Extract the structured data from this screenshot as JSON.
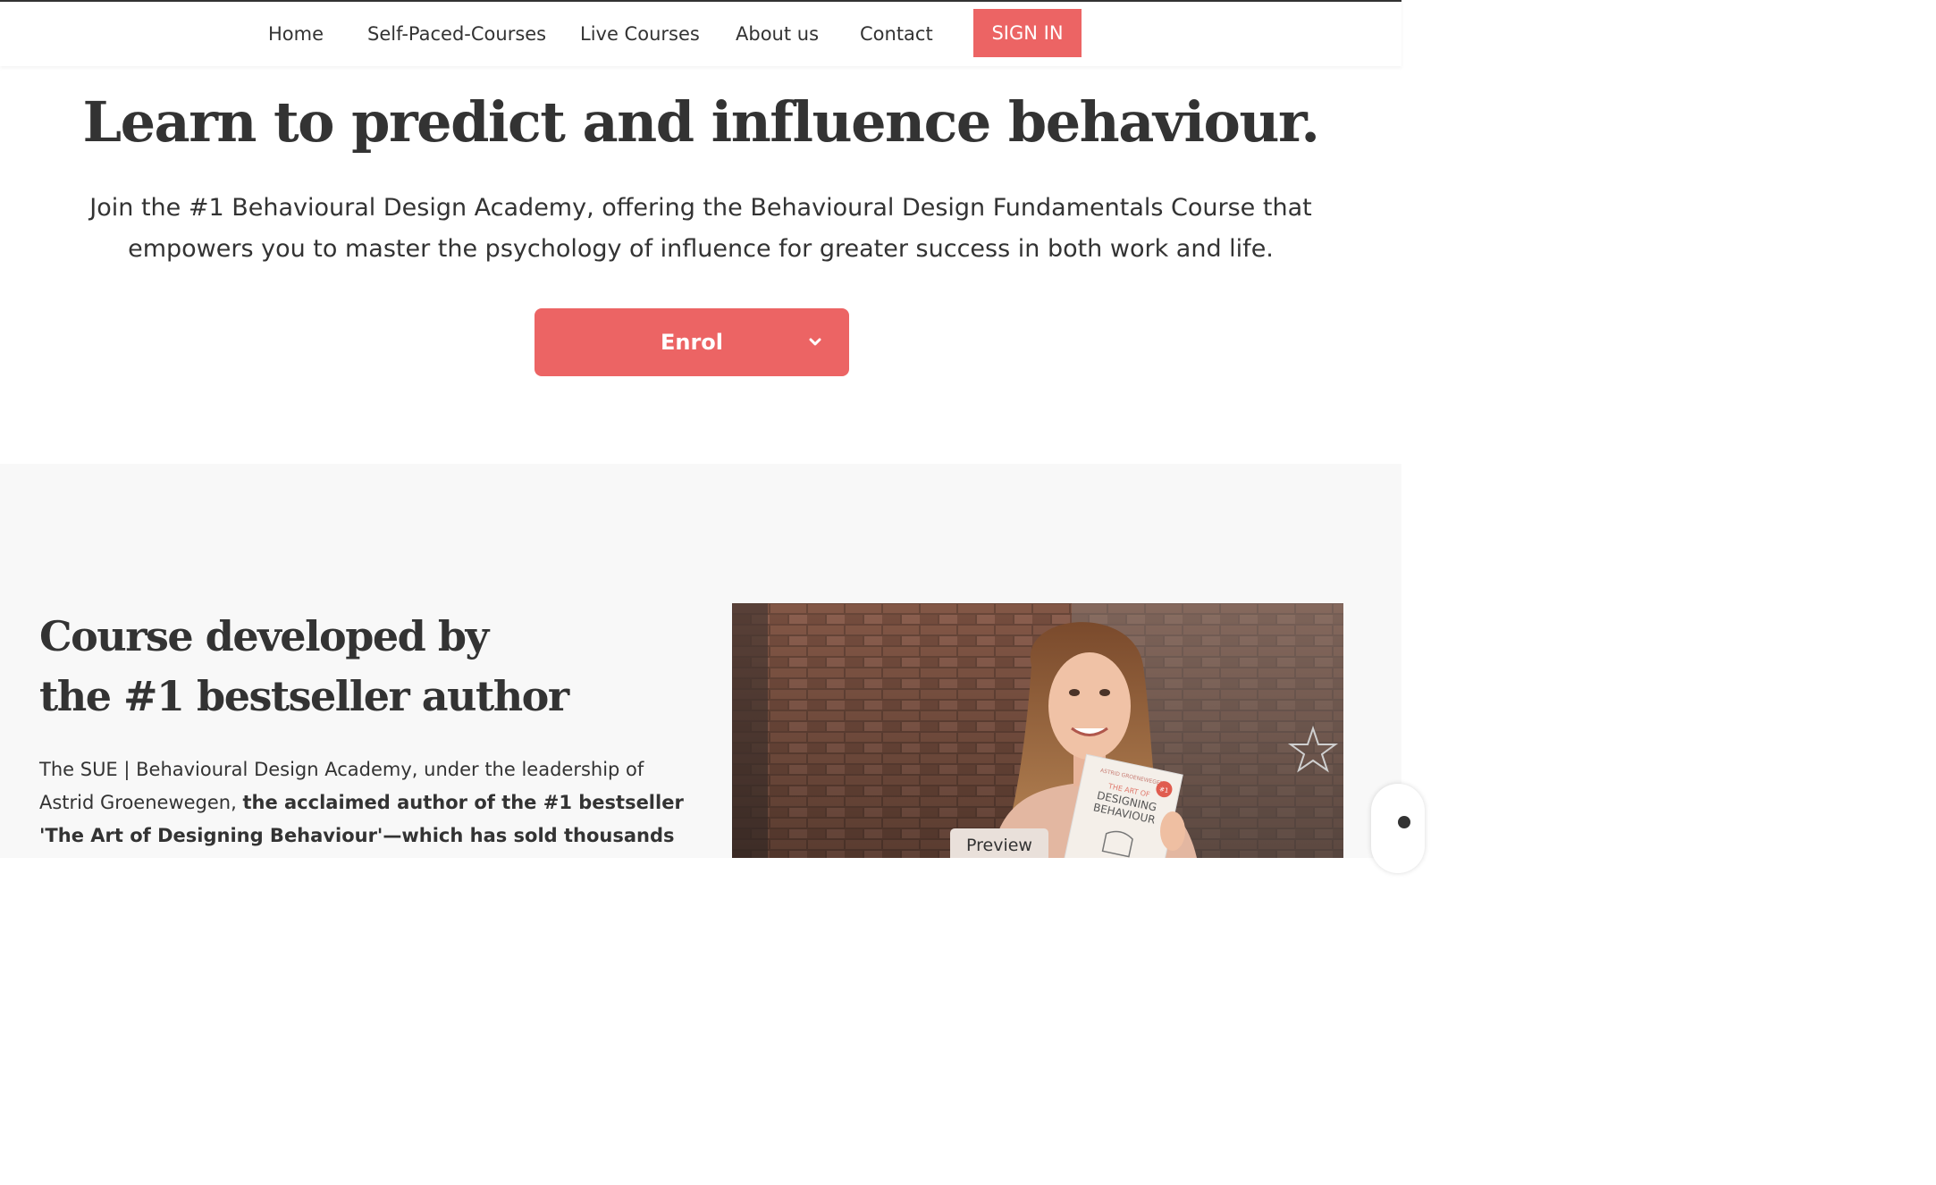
{
  "nav": {
    "items": [
      "Home",
      "Self-Paced-Courses",
      "Live Courses",
      "About us",
      "Contact"
    ],
    "signin_label": "SIGN IN"
  },
  "hero": {
    "title": "Learn to predict and influence behaviour.",
    "subtitle_line1": "Join the #1 Behavioural Design Academy, offering the Behavioural Design Fundamentals Course that",
    "subtitle_line2": "empowers you to master the psychology of influence for greater success in both work and life.",
    "enrol_label": "Enrol",
    "enrol_icon": "chevron-down-icon"
  },
  "about": {
    "title_line1": "Course developed by",
    "title_line2": "the #1 bestseller author",
    "body_line1": "The SUE | Behavioural Design Academy, under the leadership of",
    "body_line2_plain": "Astrid Groenewegen, ",
    "body_line2_bold": "the acclaimed author of the #1 bestseller",
    "body_line3_bold": "'The Art of Designing Behaviour'—which has sold thousands",
    "photo_icon": "author-photo",
    "book_author": "ASTRID GROENEWEGEN",
    "book_title_small": "THE ART OF",
    "book_title_line1": "DESIGNING",
    "book_title_line2": "BEHAVIOUR",
    "book_badge": "#1",
    "preview_label": "Preview"
  },
  "colors": {
    "accent": "#ec6464",
    "text": "#333333",
    "section_bg": "#f8f8f8"
  }
}
